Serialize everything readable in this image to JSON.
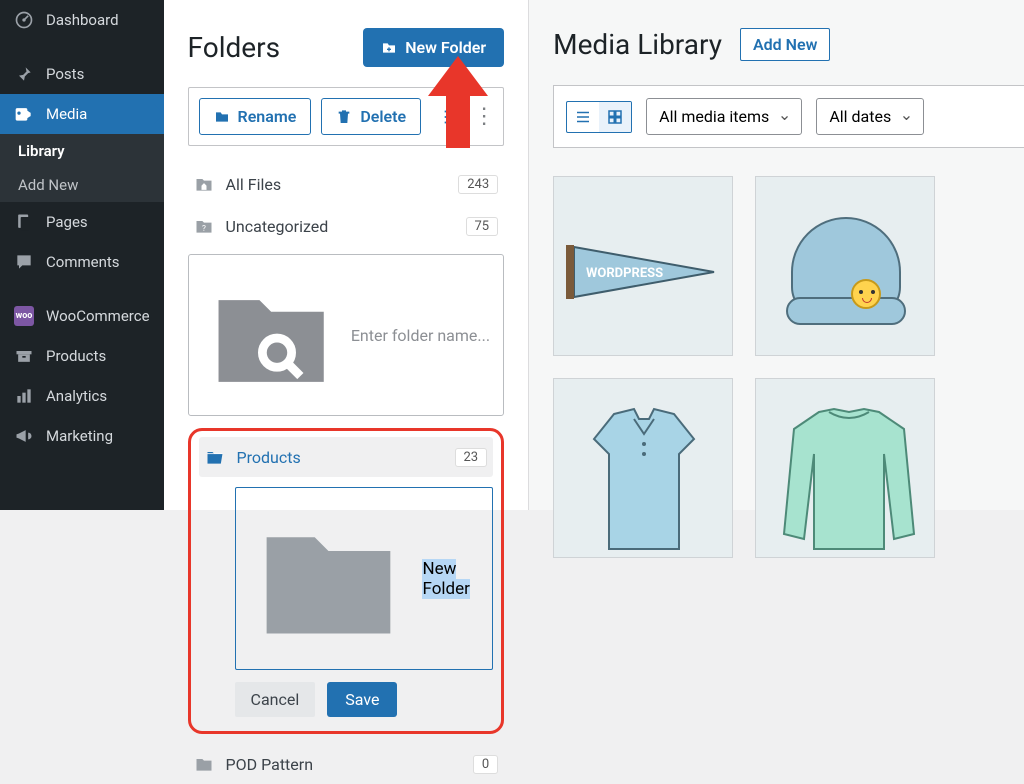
{
  "sidebar": {
    "items": [
      {
        "icon": "dashboard",
        "label": "Dashboard"
      },
      {
        "icon": "pin",
        "label": "Posts"
      },
      {
        "icon": "media",
        "label": "Media"
      },
      {
        "icon": "page",
        "label": "Pages"
      },
      {
        "icon": "comment",
        "label": "Comments"
      },
      {
        "icon": "woo",
        "label": "WooCommerce"
      },
      {
        "icon": "products",
        "label": "Products"
      },
      {
        "icon": "analytics",
        "label": "Analytics"
      },
      {
        "icon": "marketing",
        "label": "Marketing"
      }
    ],
    "sub": {
      "library": "Library",
      "addnew": "Add New"
    }
  },
  "folders": {
    "title": "Folders",
    "new_folder_btn": "New Folder",
    "rename_btn": "Rename",
    "delete_btn": "Delete",
    "search_placeholder": "Enter folder name...",
    "all_files": {
      "label": "All Files",
      "count": "243"
    },
    "uncategorized": {
      "label": "Uncategorized",
      "count": "75"
    },
    "products": {
      "label": "Products",
      "count": "23"
    },
    "new_input_value": "New Folder",
    "cancel": "Cancel",
    "save": "Save",
    "pod_pattern": {
      "label": "POD Pattern",
      "count": "0"
    }
  },
  "media": {
    "title": "Media Library",
    "add_new": "Add New",
    "filter_type": "All media items",
    "filter_date": "All dates"
  }
}
